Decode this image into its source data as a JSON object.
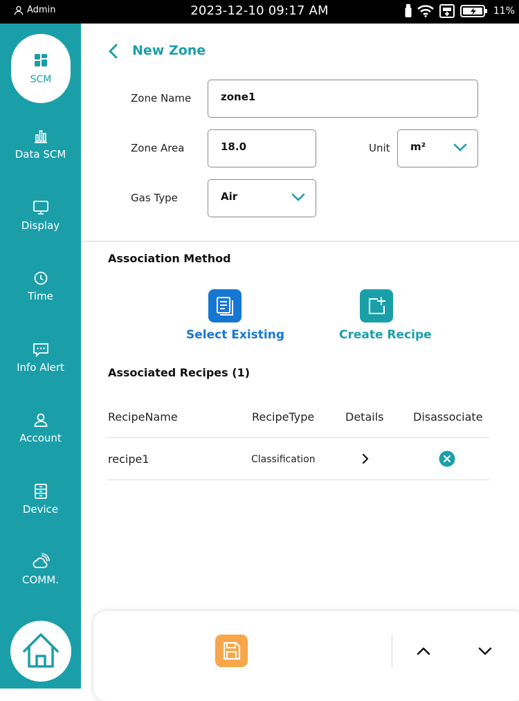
{
  "status_bar": {
    "user": "Admin",
    "datetime": "2023-12-10 09:17   AM",
    "battery": "11%"
  },
  "sidebar": {
    "items": [
      {
        "label": "SCM",
        "icon": "grid-icon",
        "active": true
      },
      {
        "label": "Data SCM",
        "icon": "bar-chart-icon"
      },
      {
        "label": "Display",
        "icon": "monitor-icon"
      },
      {
        "label": "Time",
        "icon": "clock-icon"
      },
      {
        "label": "Info Alert",
        "icon": "message-icon"
      },
      {
        "label": "Account",
        "icon": "user-icon"
      },
      {
        "label": "Device",
        "icon": "device-icon"
      },
      {
        "label": "COMM.",
        "icon": "signal-cloud-icon"
      }
    ],
    "home_icon": "home-icon"
  },
  "header": {
    "title": "New Zone"
  },
  "form": {
    "zone_name_label": "Zone Name",
    "zone_name_value": "zone1",
    "zone_area_label": "Zone Area",
    "zone_area_value": "18.0",
    "unit_label": "Unit",
    "unit_value": "m²",
    "gas_type_label": "Gas Type",
    "gas_type_value": "Air"
  },
  "association": {
    "title": "Association Method",
    "select_existing": "Select Existing",
    "create_recipe": "Create Recipe"
  },
  "recipes": {
    "title": "Associated Recipes (1)",
    "columns": [
      "RecipeName",
      "RecipeType",
      "Details",
      "Disassociate"
    ],
    "rows": [
      {
        "name": "recipe1",
        "type": "Classification"
      }
    ]
  },
  "colors": {
    "accent": "#1a9fa9",
    "select_existing": "#1677d2",
    "save": "#f7a64a"
  }
}
